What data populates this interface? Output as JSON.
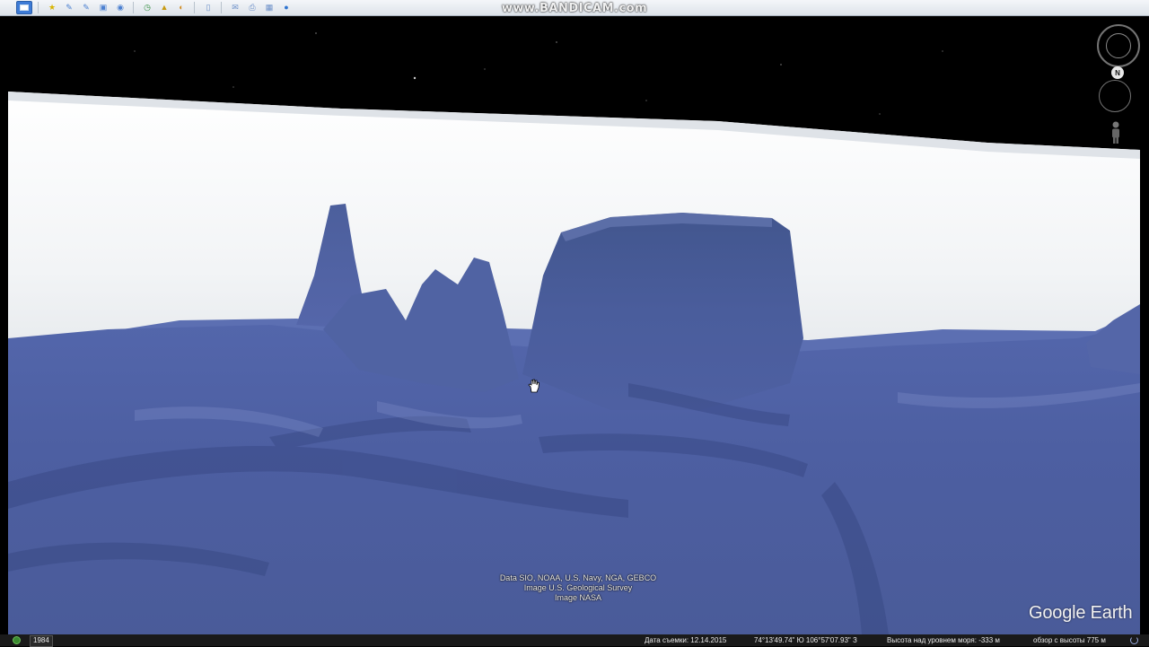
{
  "watermark": "www.BANDICAM.com",
  "toolbar": {
    "buttons": [
      {
        "name": "sidebar-toggle-button",
        "icon": "sidebar-icon"
      },
      {
        "name": "add-placemark-button",
        "icon": "placemark-icon",
        "glyph": "★",
        "color": "#d8b400"
      },
      {
        "name": "add-polygon-button",
        "icon": "polygon-icon",
        "glyph": "✎",
        "color": "#4a7fd0"
      },
      {
        "name": "add-path-button",
        "icon": "path-icon",
        "glyph": "✎",
        "color": "#4a7fd0"
      },
      {
        "name": "add-overlay-button",
        "icon": "overlay-icon",
        "glyph": "▣",
        "color": "#4a7fd0"
      },
      {
        "name": "record-tour-button",
        "icon": "tour-icon",
        "glyph": "◉",
        "color": "#4a7fd0"
      },
      {
        "name": "historical-imagery-button",
        "icon": "clock-icon",
        "glyph": "◷",
        "color": "#2e8b3a"
      },
      {
        "name": "sunlight-button",
        "icon": "sun-icon",
        "glyph": "▲",
        "color": "#c89a10"
      },
      {
        "name": "switch-planet-button",
        "icon": "planet-icon",
        "glyph": "◐",
        "color": "#d08a20"
      },
      {
        "name": "ruler-button",
        "icon": "ruler-icon",
        "glyph": "▯",
        "color": "#6b8fc8"
      },
      {
        "name": "email-button",
        "icon": "email-icon",
        "glyph": "✉",
        "color": "#6b8fc8"
      },
      {
        "name": "print-button",
        "icon": "print-icon",
        "glyph": "⎙",
        "color": "#6b8fc8"
      },
      {
        "name": "save-image-button",
        "icon": "save-image-icon",
        "glyph": "▦",
        "color": "#6b8fc8"
      },
      {
        "name": "google-maps-button",
        "icon": "globe-icon",
        "glyph": "●",
        "color": "#2f74d0"
      }
    ]
  },
  "credits": {
    "line1": "Data SIO, NOAA, U.S. Navy, NGA, GEBCO",
    "line2": "Image U.S. Geological Survey",
    "line3": "Image NASA"
  },
  "logo": "Google Earth",
  "nav": {
    "north_label": "N"
  },
  "statusbar": {
    "year": "1984",
    "imagery_date": "Дата съемки: 12.14.2015",
    "coordinates": "74°13'49.74\" Ю   106°57'07.93\" З",
    "elevation": "Высота над уровнем моря:   -333 м",
    "eye_altitude": "обзор с высоты   775 м"
  },
  "colors": {
    "seafloor": "#4a5d9e",
    "haze": "#f4f6f8",
    "space": "#000000"
  }
}
